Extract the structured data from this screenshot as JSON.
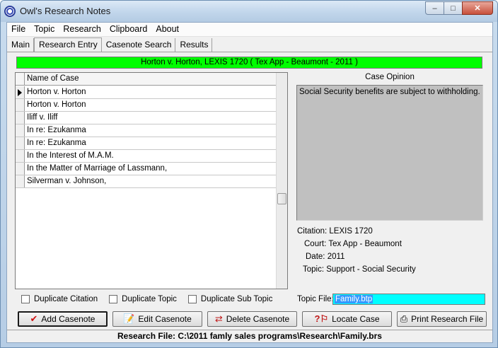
{
  "window": {
    "title": "Owl's Research Notes"
  },
  "menu": [
    "File",
    "Topic",
    "Research",
    "Clipboard",
    "About"
  ],
  "tabs": [
    {
      "label": "Main",
      "active": false
    },
    {
      "label": "Research Entry",
      "active": true
    },
    {
      "label": "Casenote Search",
      "active": false
    },
    {
      "label": "Results",
      "active": false
    }
  ],
  "case_banner": "Horton v. Horton, LEXIS 1720  ( Tex App - Beaumont - 2011 )",
  "grid": {
    "header": "Name of Case",
    "rows": [
      "Horton v. Horton",
      "Horton v. Horton",
      "Iliff v. Iliff",
      "In re: Ezukanma",
      "In re: Ezukanma",
      "In the Interest of M.A.M.",
      "In the Matter of Marriage of Lassmann,",
      "Silverman v. Johnson,"
    ]
  },
  "opinion": {
    "label": "Case Opinion",
    "text": "Social Security benefits are subject to withholding."
  },
  "details": {
    "citation_label": "Citation:",
    "citation": "LEXIS 1720",
    "court_label": "Court:",
    "court": "Tex App - Beaumont",
    "date_label": "Date:",
    "date": "2011",
    "topic_label": "Topic:",
    "topic": "Support - Social Security"
  },
  "checkboxes": [
    "Duplicate Citation",
    "Duplicate Topic",
    "Duplicate Sub Topic"
  ],
  "topic_file": {
    "label": "Topic File:",
    "value": "Family.btp"
  },
  "buttons": {
    "add": "Add Casenote",
    "edit": "Edit Casenote",
    "delete": "Delete Casenote",
    "locate": "Locate Case",
    "print": "Print Research File"
  },
  "status": "Research File: C:\\2011 famly sales programs\\Research\\Family.brs",
  "colors": {
    "banner": "#00ff00",
    "topic_file_bg": "#00ffff",
    "opinion_bg": "#c0c0c0"
  }
}
